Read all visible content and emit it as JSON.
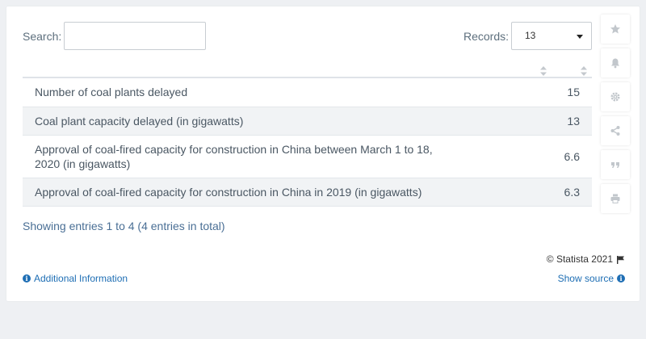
{
  "search": {
    "label": "Search:",
    "value": ""
  },
  "records": {
    "label": "Records:",
    "selected": "13"
  },
  "table": {
    "rows": [
      {
        "label": "Number of coal plants delayed",
        "value": "15"
      },
      {
        "label": "Coal plant capacity delayed (in gigawatts)",
        "value": "13"
      },
      {
        "label": "Approval of coal-fired capacity for construction in China between March 1 to 18, 2020 (in gigawatts)",
        "value": "6.6"
      },
      {
        "label": "Approval of coal-fired capacity for construction in China in 2019 (in gigawatts)",
        "value": "6.3"
      }
    ]
  },
  "summary": "Showing entries 1 to 4 (4 entries in total)",
  "footer": {
    "copyright": "© Statista 2021",
    "additional_info": "Additional Information",
    "show_source": "Show source"
  },
  "sidebar_icons": [
    "star-icon",
    "bell-icon",
    "gear-icon",
    "share-icon",
    "quote-icon",
    "print-icon"
  ],
  "colors": {
    "accent_link": "#1e6eb4",
    "summary_text": "#4a6f95",
    "row_alt": "#f1f3f5",
    "page_bg": "#eef0f3"
  }
}
